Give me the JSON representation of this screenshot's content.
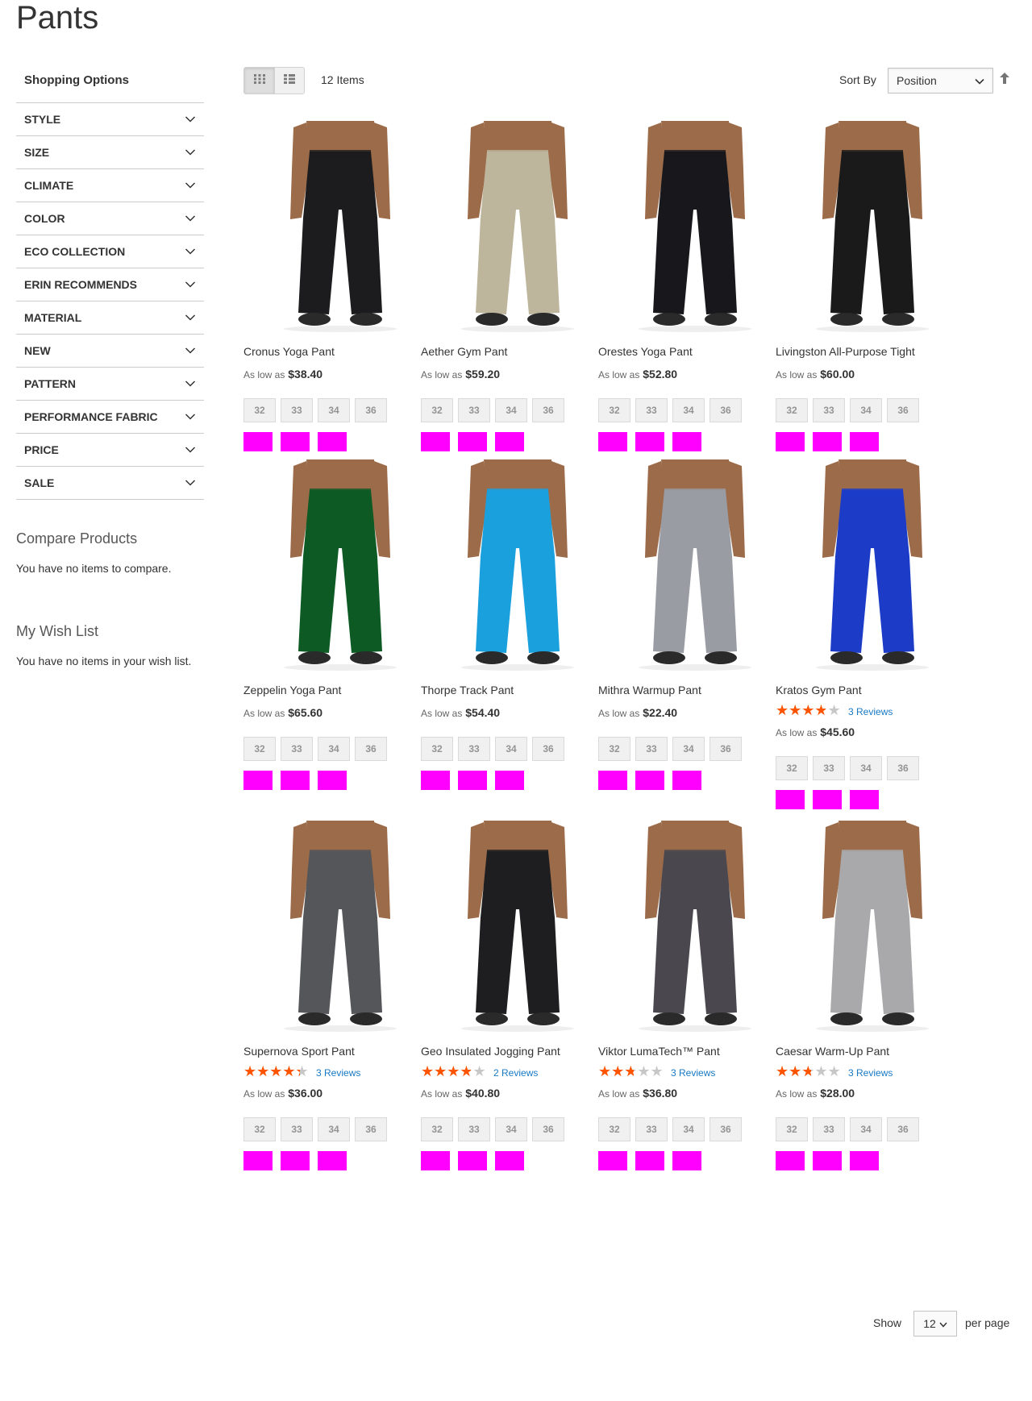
{
  "page": {
    "title": "Pants"
  },
  "sidebar": {
    "title": "Shopping Options",
    "filters": [
      {
        "label": "STYLE"
      },
      {
        "label": "SIZE"
      },
      {
        "label": "CLIMATE"
      },
      {
        "label": "COLOR"
      },
      {
        "label": "ECO COLLECTION"
      },
      {
        "label": "ERIN RECOMMENDS"
      },
      {
        "label": "MATERIAL"
      },
      {
        "label": "NEW"
      },
      {
        "label": "PATTERN"
      },
      {
        "label": "PERFORMANCE FABRIC"
      },
      {
        "label": "PRICE"
      },
      {
        "label": "SALE"
      }
    ],
    "compare": {
      "title": "Compare Products",
      "text": "You have no items to compare."
    },
    "wishlist": {
      "title": "My Wish List",
      "text": "You have no items in your wish list."
    }
  },
  "toolbar": {
    "grid_mode_icon": "grid-icon",
    "list_mode_icon": "list-icon",
    "items_count": "12 Items",
    "sort_label": "Sort By",
    "sort_value": "Position",
    "sort_direction_icon": "arrow-up-icon",
    "show_label": "Show",
    "limit_value": "12",
    "per_page_label": "per page"
  },
  "price_prefix": "As low as",
  "swatch_color": "#ff00ff",
  "star_color": "#ff5501",
  "products": [
    {
      "name": "Cronus Yoga Pant",
      "price": "$38.40",
      "sizes": [
        "32",
        "33",
        "34",
        "36"
      ],
      "rating": null,
      "reviews": "",
      "color": "#1c1c1e"
    },
    {
      "name": "Aether Gym Pant",
      "price": "$59.20",
      "sizes": [
        "32",
        "33",
        "34",
        "36"
      ],
      "rating": null,
      "reviews": "",
      "color": "#bdb59c"
    },
    {
      "name": "Orestes Yoga Pant",
      "price": "$52.80",
      "sizes": [
        "32",
        "33",
        "34",
        "36"
      ],
      "rating": null,
      "reviews": "",
      "color": "#18181c"
    },
    {
      "name": "Livingston All-Purpose Tight",
      "price": "$60.00",
      "sizes": [
        "32",
        "33",
        "34",
        "36"
      ],
      "rating": null,
      "reviews": "",
      "color": "#1a1a1a"
    },
    {
      "name": "Zeppelin Yoga Pant",
      "price": "$65.60",
      "sizes": [
        "32",
        "33",
        "34",
        "36"
      ],
      "rating": null,
      "reviews": "",
      "color": "#0d5a24"
    },
    {
      "name": "Thorpe Track Pant",
      "price": "$54.40",
      "sizes": [
        "32",
        "33",
        "34",
        "36"
      ],
      "rating": null,
      "reviews": "",
      "color": "#1ba0de"
    },
    {
      "name": "Mithra Warmup Pant",
      "price": "$22.40",
      "sizes": [
        "32",
        "33",
        "34",
        "36"
      ],
      "rating": null,
      "reviews": "",
      "color": "#9a9ca4"
    },
    {
      "name": "Kratos Gym Pant",
      "price": "$45.60",
      "sizes": [
        "32",
        "33",
        "34",
        "36"
      ],
      "rating": 0.7,
      "reviews": "3 Reviews",
      "color": "#1c3cc8"
    },
    {
      "name": "Supernova Sport Pant",
      "price": "$36.00",
      "sizes": [
        "32",
        "33",
        "34",
        "36"
      ],
      "rating": 0.8,
      "reviews": "3 Reviews",
      "color": "#55565a"
    },
    {
      "name": "Geo Insulated Jogging Pant",
      "price": "$40.80",
      "sizes": [
        "32",
        "33",
        "34",
        "36"
      ],
      "rating": 0.7,
      "reviews": "2 Reviews",
      "color": "#1e1e20"
    },
    {
      "name": "Viktor LumaTech™ Pant",
      "price": "$36.80",
      "sizes": [
        "32",
        "33",
        "34",
        "36"
      ],
      "rating": 0.5,
      "reviews": "3 Reviews",
      "color": "#4a484e"
    },
    {
      "name": "Caesar Warm-Up Pant",
      "price": "$28.00",
      "sizes": [
        "32",
        "33",
        "34",
        "36"
      ],
      "rating": 0.5,
      "reviews": "3 Reviews",
      "color": "#a9a9ab"
    }
  ]
}
